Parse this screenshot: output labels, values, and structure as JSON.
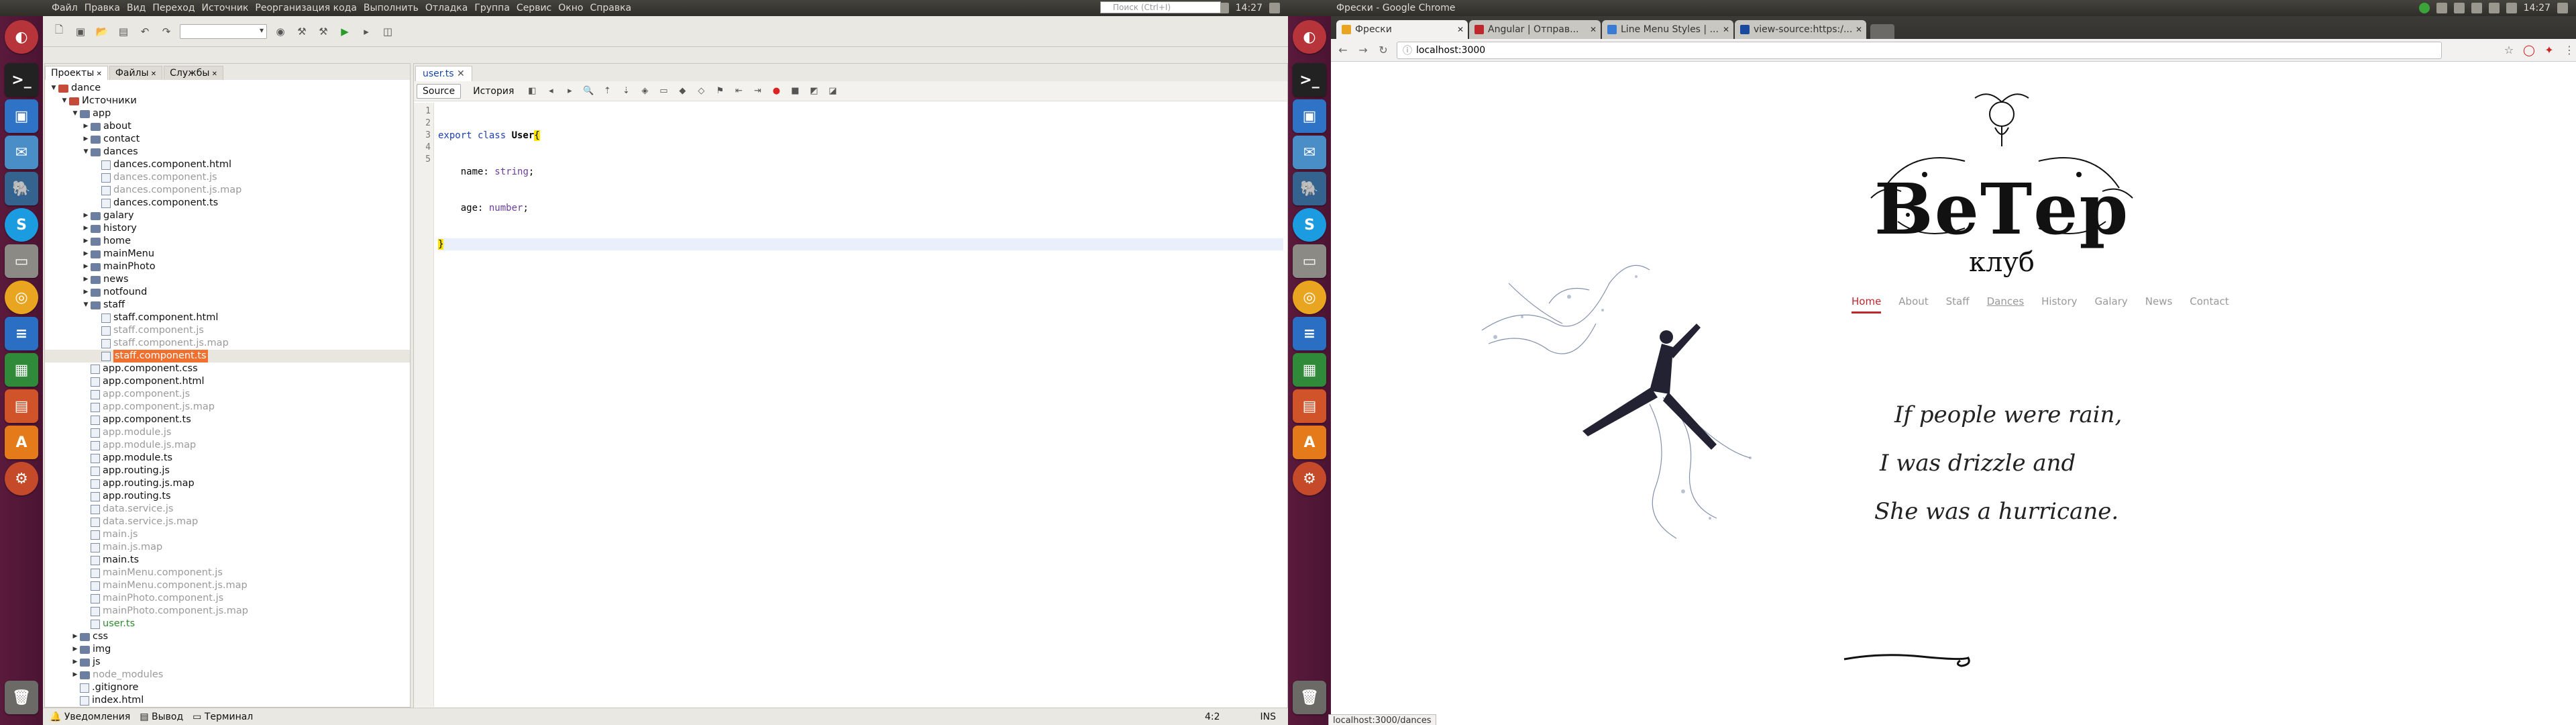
{
  "left": {
    "menu": [
      "Файл",
      "Правка",
      "Вид",
      "Переход",
      "Источник",
      "Реорганизация кода",
      "Выполнить",
      "Отладка",
      "Группа",
      "Сервис",
      "Окно",
      "Справка"
    ],
    "search_placeholder": "Поиск (Ctrl+I)",
    "clock": "14:27",
    "project_tabs": [
      "Проекты",
      "Файлы",
      "Службы"
    ],
    "tree": [
      {
        "label": "dance",
        "depth": 0,
        "kind": "project",
        "open": true
      },
      {
        "label": "Источники",
        "depth": 1,
        "kind": "src",
        "open": true
      },
      {
        "label": "app",
        "depth": 2,
        "kind": "folder",
        "open": true
      },
      {
        "label": "about",
        "depth": 3,
        "kind": "folder"
      },
      {
        "label": "contact",
        "depth": 3,
        "kind": "folder"
      },
      {
        "label": "dances",
        "depth": 3,
        "kind": "folder",
        "open": true
      },
      {
        "label": "dances.component.html",
        "depth": 4,
        "kind": "file"
      },
      {
        "label": "dances.component.js",
        "depth": 4,
        "kind": "file",
        "style": "grey"
      },
      {
        "label": "dances.component.js.map",
        "depth": 4,
        "kind": "file",
        "style": "grey"
      },
      {
        "label": "dances.component.ts",
        "depth": 4,
        "kind": "file"
      },
      {
        "label": "galary",
        "depth": 3,
        "kind": "folder"
      },
      {
        "label": "history",
        "depth": 3,
        "kind": "folder"
      },
      {
        "label": "home",
        "depth": 3,
        "kind": "folder"
      },
      {
        "label": "mainMenu",
        "depth": 3,
        "kind": "folder"
      },
      {
        "label": "mainPhoto",
        "depth": 3,
        "kind": "folder"
      },
      {
        "label": "news",
        "depth": 3,
        "kind": "folder"
      },
      {
        "label": "notfound",
        "depth": 3,
        "kind": "folder"
      },
      {
        "label": "staff",
        "depth": 3,
        "kind": "folder",
        "open": true
      },
      {
        "label": "staff.component.html",
        "depth": 4,
        "kind": "file"
      },
      {
        "label": "staff.component.js",
        "depth": 4,
        "kind": "file",
        "style": "grey"
      },
      {
        "label": "staff.component.js.map",
        "depth": 4,
        "kind": "file",
        "style": "grey"
      },
      {
        "label": "staff.component.ts",
        "depth": 4,
        "kind": "file",
        "style": "selected"
      },
      {
        "label": "app.component.css",
        "depth": 3,
        "kind": "file"
      },
      {
        "label": "app.component.html",
        "depth": 3,
        "kind": "file"
      },
      {
        "label": "app.component.js",
        "depth": 3,
        "kind": "file",
        "style": "grey"
      },
      {
        "label": "app.component.js.map",
        "depth": 3,
        "kind": "file",
        "style": "grey"
      },
      {
        "label": "app.component.ts",
        "depth": 3,
        "kind": "file"
      },
      {
        "label": "app.module.js",
        "depth": 3,
        "kind": "file",
        "style": "grey"
      },
      {
        "label": "app.module.js.map",
        "depth": 3,
        "kind": "file",
        "style": "grey"
      },
      {
        "label": "app.module.ts",
        "depth": 3,
        "kind": "file"
      },
      {
        "label": "app.routing.js",
        "depth": 3,
        "kind": "file"
      },
      {
        "label": "app.routing.js.map",
        "depth": 3,
        "kind": "file"
      },
      {
        "label": "app.routing.ts",
        "depth": 3,
        "kind": "file"
      },
      {
        "label": "data.service.js",
        "depth": 3,
        "kind": "file",
        "style": "grey"
      },
      {
        "label": "data.service.js.map",
        "depth": 3,
        "kind": "file",
        "style": "grey"
      },
      {
        "label": "main.js",
        "depth": 3,
        "kind": "file",
        "style": "grey"
      },
      {
        "label": "main.js.map",
        "depth": 3,
        "kind": "file",
        "style": "grey"
      },
      {
        "label": "main.ts",
        "depth": 3,
        "kind": "file"
      },
      {
        "label": "mainMenu.component.js",
        "depth": 3,
        "kind": "file",
        "style": "grey"
      },
      {
        "label": "mainMenu.component.js.map",
        "depth": 3,
        "kind": "file",
        "style": "grey"
      },
      {
        "label": "mainPhoto.component.js",
        "depth": 3,
        "kind": "file",
        "style": "grey"
      },
      {
        "label": "mainPhoto.component.js.map",
        "depth": 3,
        "kind": "file",
        "style": "grey"
      },
      {
        "label": "user.ts",
        "depth": 3,
        "kind": "file",
        "style": "green"
      },
      {
        "label": "css",
        "depth": 2,
        "kind": "folder"
      },
      {
        "label": "img",
        "depth": 2,
        "kind": "folder"
      },
      {
        "label": "js",
        "depth": 2,
        "kind": "folder"
      },
      {
        "label": "node_modules",
        "depth": 2,
        "kind": "folder",
        "style": "grey"
      },
      {
        "label": ".gitignore",
        "depth": 2,
        "kind": "file"
      },
      {
        "label": "index.html",
        "depth": 2,
        "kind": "file"
      }
    ],
    "editor_tab": "user.ts",
    "source_btn": "Source",
    "history_btn": "История",
    "line_numbers": [
      "1",
      "2",
      "3",
      "4",
      "5"
    ],
    "code": {
      "l1_kw": "export class ",
      "l1_name": "User",
      "l1_brace": "{",
      "l2": "    name: ",
      "l2_type": "string",
      "l3": "    age: ",
      "l3_type": "number",
      "l4": "}"
    },
    "status": {
      "notifications": "Уведомления",
      "output": "Вывод",
      "terminal": "Терминал",
      "position": "4:2",
      "mode": "INS"
    }
  },
  "right": {
    "window_title": "Фрески - Google Chrome",
    "clock": "14:27",
    "tabs": [
      "Фрески",
      "Angular | Отправ...",
      "Line Menu Styles | ...",
      "view-source:https:/..."
    ],
    "url": "localhost:3000",
    "logo_word": "ВеТер",
    "logo_sub": "клуб",
    "nav": [
      "Home",
      "About",
      "Staff",
      "Dances",
      "History",
      "Galary",
      "News",
      "Contact"
    ],
    "nav_active": "Home",
    "nav_hover": "Dances",
    "quote": [
      "If people were rain,",
      "I was drizzle and",
      "She was a hurricane."
    ],
    "status_url": "localhost:3000/dances",
    "colors": {
      "accent": "#c0272d",
      "launcher": "#5a1a3c",
      "ide_bg": "#e9e8e2",
      "selected": "#f07030"
    }
  }
}
